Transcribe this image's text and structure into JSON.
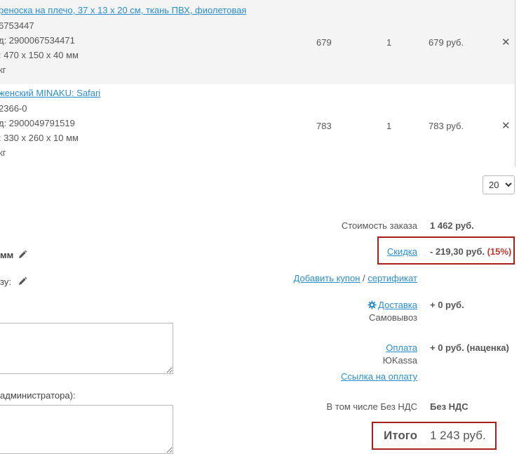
{
  "items": [
    {
      "name": "реноска на плечо, 37 х 13 х 20 см, ткань ПВХ, фиолетовая",
      "meta": [
        "6753447",
        "д: 2900067534471",
        ": 470 х 150 х 40 мм",
        " кг"
      ],
      "price": "679",
      "qty": "1",
      "sum": "679 руб."
    },
    {
      "name": "женский MINAKU: Safari",
      "meta": [
        "2366-0",
        "д: 2900049791519",
        ": 330 х 260 х 10 мм",
        " кг"
      ],
      "price": "783",
      "qty": "1",
      "sum": "783 руб."
    }
  ],
  "per_page": {
    "options": [
      "20"
    ],
    "selected": "20"
  },
  "left_labels": {
    "mm": "мм",
    "vu": "зу:",
    "admin": "администратора):"
  },
  "summary": {
    "order_cost_label": "Стоимость заказа",
    "order_cost_value": "1 462 руб.",
    "discount_label": "Скидка",
    "discount_value": "- 219,30 руб.",
    "discount_percent": "(15%)",
    "add_coupon": "Добавить купон",
    "slash": "/",
    "certificate": "сертификат",
    "delivery_label": "Доставка",
    "delivery_value": "+ 0 руб.",
    "delivery_method": "Самовывоз",
    "payment_label": "Оплата",
    "payment_value": "+ 0 руб. (наценка)",
    "payment_method": "ЮKassa",
    "payment_link": "Ссылка на оплату",
    "vat_label": "В том числе Без НДС",
    "vat_value": "Без НДС",
    "total_label": "Итого",
    "total_value": "1 243 руб."
  },
  "colors": {
    "link": "#2a8fd1",
    "highlight_border": "#a8201a",
    "percent": "#c0392b"
  },
  "icons": {
    "delete": "close-icon",
    "edit": "pencil-icon",
    "settings": "gear-icon"
  }
}
